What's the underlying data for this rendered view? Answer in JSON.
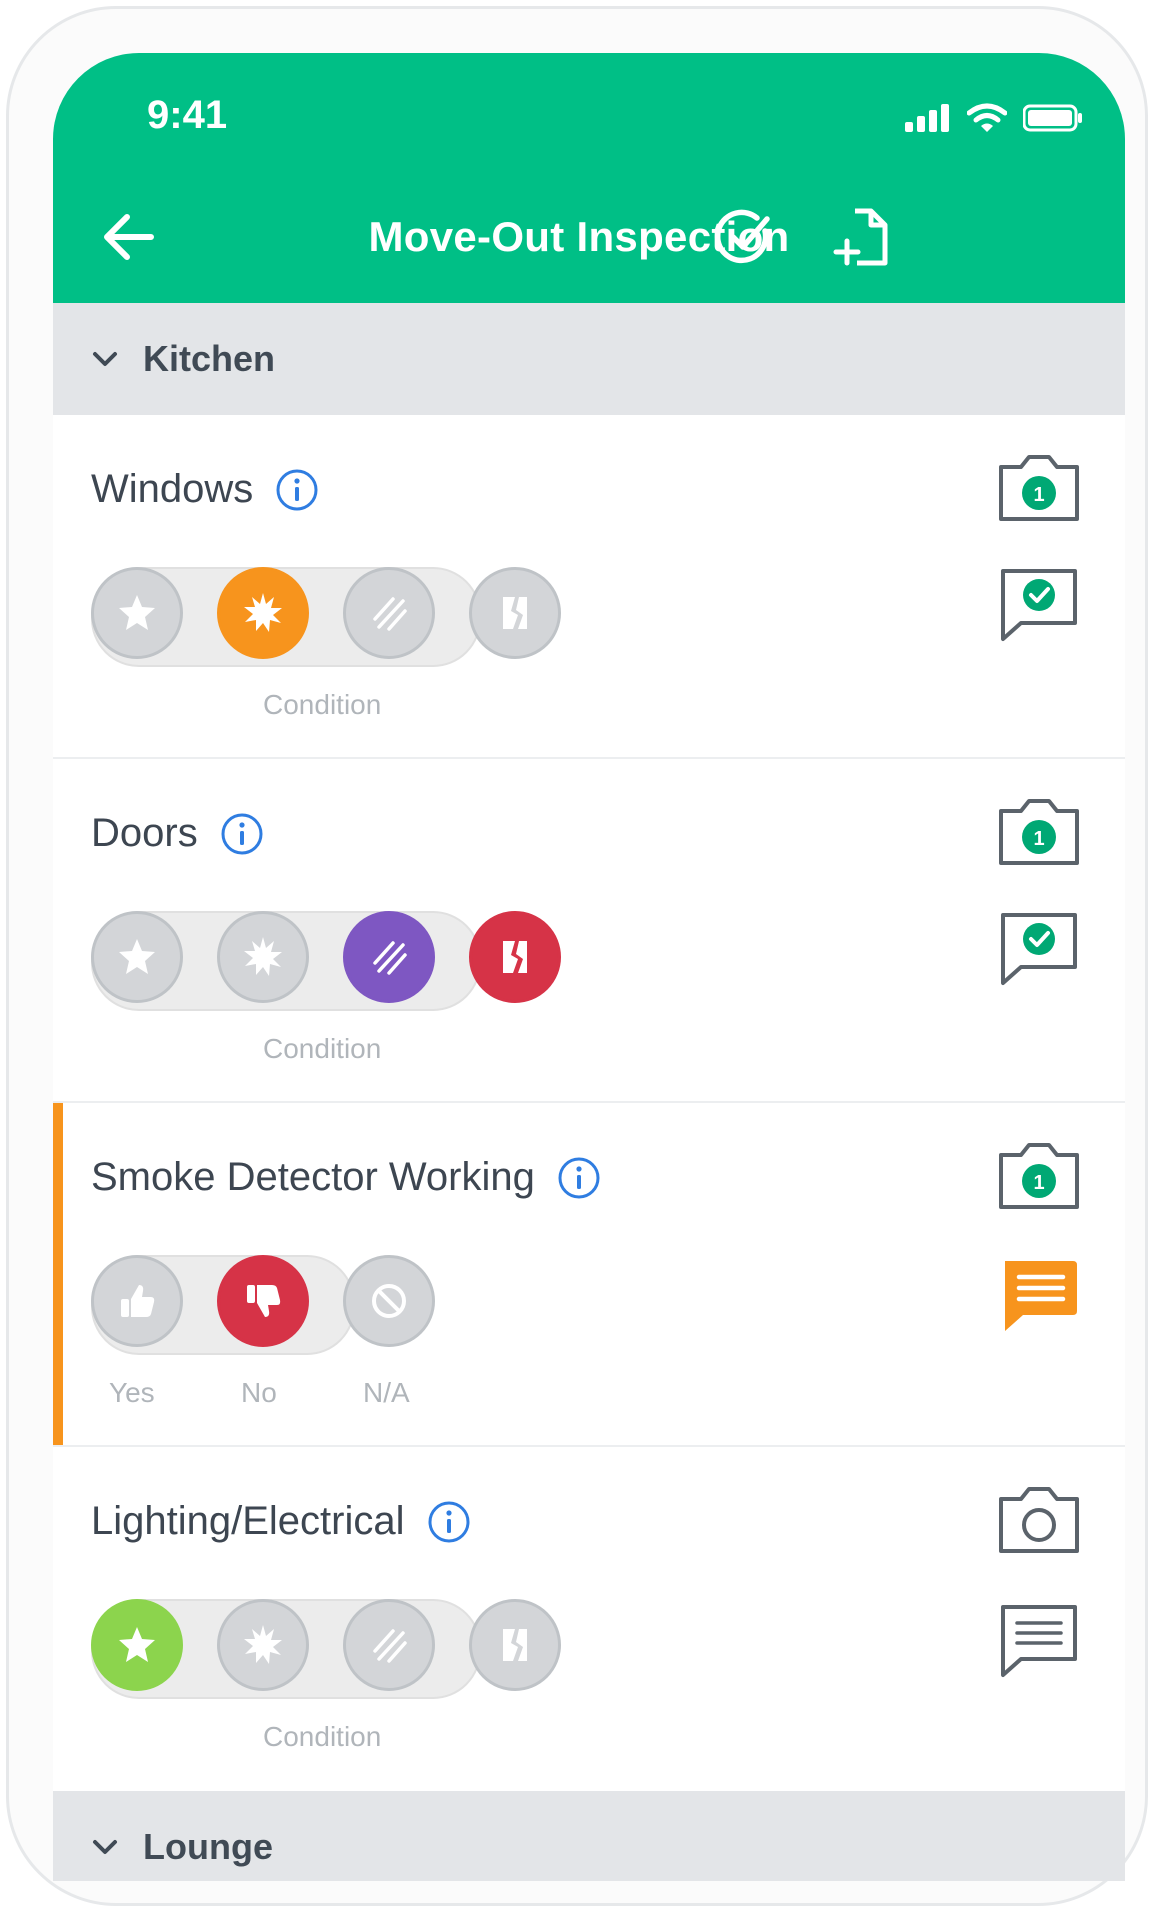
{
  "status_bar": {
    "time": "9:41"
  },
  "header": {
    "title": "Move-Out Inspection",
    "back_icon": "back-arrow-icon",
    "complete_icon": "check-circle-icon",
    "add_doc_icon": "add-document-icon"
  },
  "colors": {
    "brand": "#00bf86",
    "orange": "#f7941d",
    "purple": "#7e57c2",
    "red": "#d63347",
    "green": "#8cd44d",
    "info_blue": "#2f7de1"
  },
  "sections": [
    {
      "label": "Kitchen"
    },
    {
      "label": "Lounge"
    }
  ],
  "items": [
    {
      "title": "Windows",
      "control": "condition",
      "sublabel": "Condition",
      "selected": [
        "damaged"
      ],
      "photo_count": "1",
      "comment": "complete"
    },
    {
      "title": "Doors",
      "control": "condition",
      "sublabel": "Condition",
      "selected": [
        "scratched",
        "broken"
      ],
      "photo_count": "1",
      "comment": "complete"
    },
    {
      "title": "Smoke Detector Working",
      "control": "yes_no",
      "options": [
        "Yes",
        "No",
        "N/A"
      ],
      "selected": [
        "No"
      ],
      "photo_count": "1",
      "comment": "has-note",
      "flagged": true
    },
    {
      "title": "Lighting/Electrical",
      "control": "condition",
      "sublabel": "Condition",
      "selected": [
        "good"
      ],
      "photo_count": "",
      "comment": "empty"
    }
  ]
}
